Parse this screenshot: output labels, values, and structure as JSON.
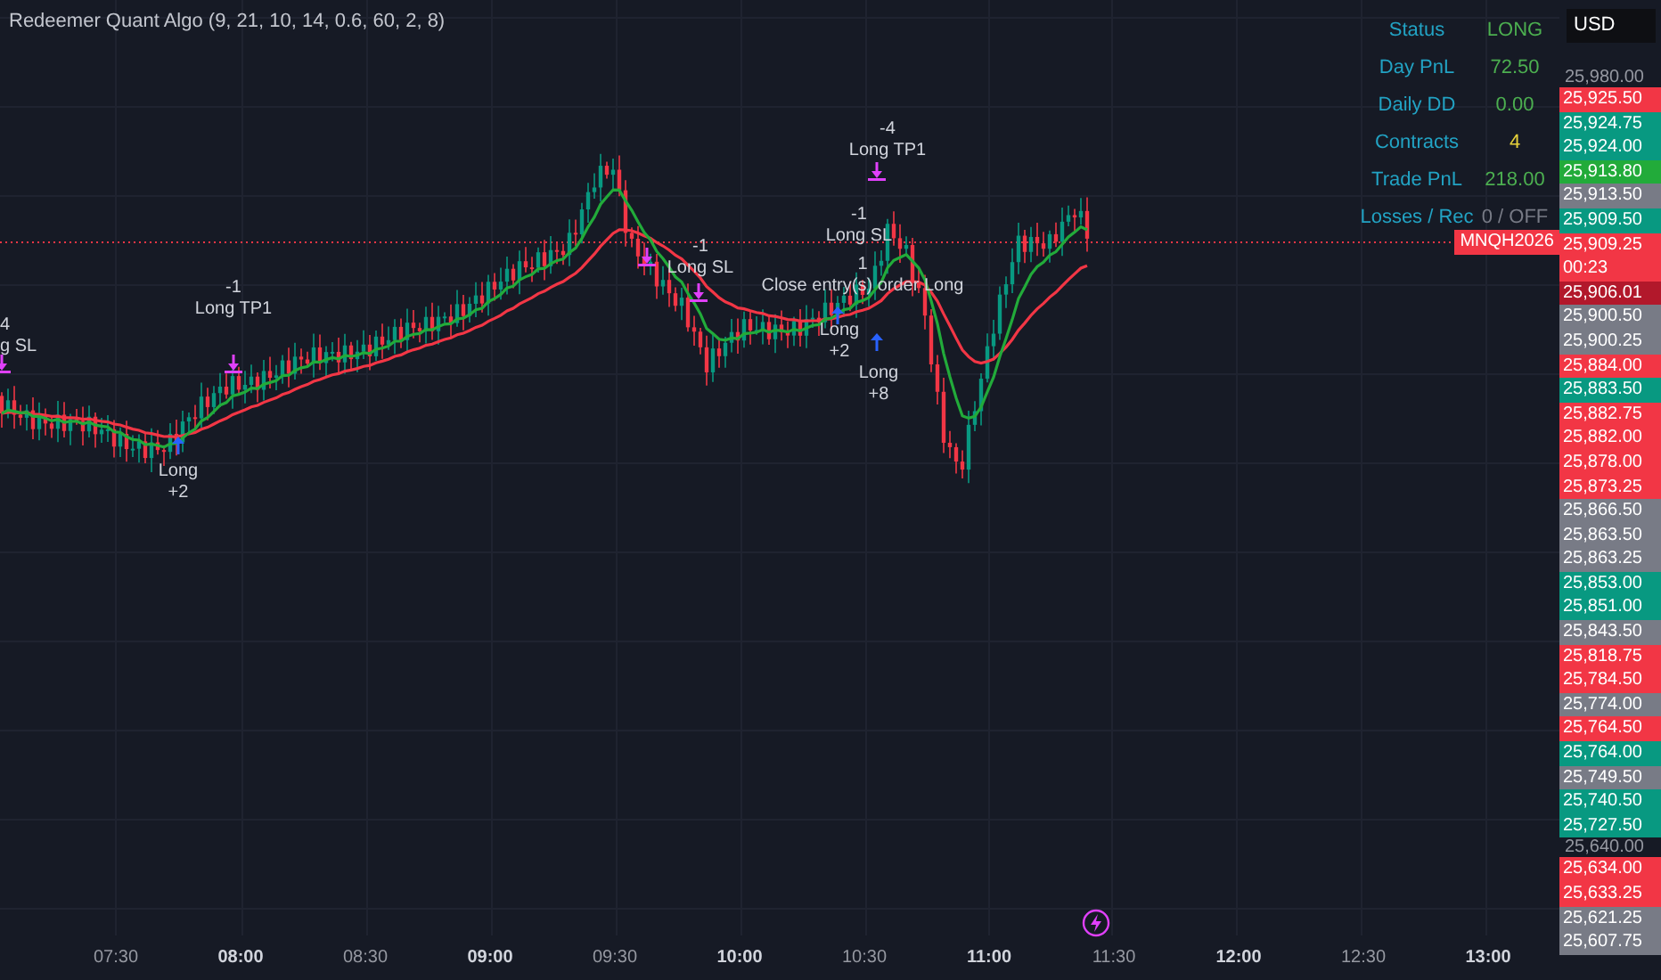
{
  "indicator": {
    "title": "Redeemer Quant Algo (9, 21, 10, 14, 0.6, 60, 2, 8)"
  },
  "stats": [
    {
      "label": "Status",
      "value": "LONG",
      "color": "#4caf50"
    },
    {
      "label": "Day PnL",
      "value": "72.50",
      "color": "#4caf50"
    },
    {
      "label": "Daily DD",
      "value": "0.00",
      "color": "#4caf50"
    },
    {
      "label": "Contracts",
      "value": "4",
      "color": "#e6d13a"
    },
    {
      "label": "Trade PnL",
      "value": "218.00",
      "color": "#4caf50"
    },
    {
      "label": "Losses / Rec",
      "value": "0 / OFF",
      "color": "#787b86"
    }
  ],
  "signals": [
    {
      "kind": "exit",
      "qty": "4",
      "label": "g SL"
    },
    {
      "kind": "exit",
      "qty": "-1",
      "label": "Long TP1"
    },
    {
      "kind": "entry",
      "qty": "+2",
      "label": "Long"
    },
    {
      "kind": "exit",
      "qty": "-1",
      "label": "Long SL"
    },
    {
      "kind": "exit",
      "qty": "-4",
      "label": "Long TP1"
    },
    {
      "kind": "exit",
      "qty": "-1",
      "label": "Long SL"
    },
    {
      "kind": "exit",
      "qty": "1",
      "label": "Close entry(s) order Long"
    },
    {
      "kind": "entry",
      "qty": "+2",
      "label": "Long"
    },
    {
      "kind": "entry",
      "qty": "+8",
      "label": "Long"
    }
  ],
  "symbol_tag": {
    "text": "MNQH2026"
  },
  "currency": {
    "text": "USD"
  },
  "price_scale": [
    {
      "kind": "tick",
      "text": "25,980.00"
    },
    {
      "kind": "tag",
      "text": "25,925.50",
      "color": "#f23645"
    },
    {
      "kind": "tag",
      "text": "25,924.75",
      "color": "#089981"
    },
    {
      "kind": "tag",
      "text": "25,924.00",
      "color": "#089981"
    },
    {
      "kind": "tag",
      "text": "25,913.80",
      "color": "#22ab3a"
    },
    {
      "kind": "tag",
      "text": "25,913.50",
      "color": "#787b86"
    },
    {
      "kind": "tag",
      "text": "25,909.50",
      "color": "#089981"
    },
    {
      "kind": "tag",
      "text": "25,909.25",
      "sub": "00:23",
      "color": "#f23645"
    },
    {
      "kind": "tag",
      "text": "25,906.01",
      "color": "#b2182b"
    },
    {
      "kind": "tag",
      "text": "25,900.50",
      "color": "#787b86"
    },
    {
      "kind": "tag",
      "text": "25,900.25",
      "color": "#787b86"
    },
    {
      "kind": "tag",
      "text": "25,884.00",
      "color": "#f23645"
    },
    {
      "kind": "tag",
      "text": "25,883.50",
      "color": "#089981"
    },
    {
      "kind": "tag",
      "text": "25,882.75",
      "color": "#f23645"
    },
    {
      "kind": "tag",
      "text": "25,882.00",
      "color": "#f23645"
    },
    {
      "kind": "tag",
      "text": "25,878.00",
      "color": "#f23645"
    },
    {
      "kind": "tag",
      "text": "25,873.25",
      "color": "#f23645"
    },
    {
      "kind": "tag",
      "text": "25,866.50",
      "color": "#787b86"
    },
    {
      "kind": "tag",
      "text": "25,863.50",
      "color": "#787b86"
    },
    {
      "kind": "tag",
      "text": "25,863.25",
      "color": "#787b86"
    },
    {
      "kind": "tag",
      "text": "25,853.00",
      "color": "#089981"
    },
    {
      "kind": "tag",
      "text": "25,851.00",
      "color": "#089981"
    },
    {
      "kind": "tag",
      "text": "25,843.50",
      "color": "#787b86"
    },
    {
      "kind": "tag",
      "text": "25,818.75",
      "color": "#f23645"
    },
    {
      "kind": "tag",
      "text": "25,784.50",
      "color": "#f23645"
    },
    {
      "kind": "tag",
      "text": "25,774.00",
      "color": "#787b86"
    },
    {
      "kind": "tag",
      "text": "25,764.50",
      "color": "#f23645"
    },
    {
      "kind": "tag",
      "text": "25,764.00",
      "color": "#089981"
    },
    {
      "kind": "tag",
      "text": "25,749.50",
      "color": "#787b86"
    },
    {
      "kind": "tag",
      "text": "25,740.50",
      "color": "#089981"
    },
    {
      "kind": "tag",
      "text": "25,727.50",
      "color": "#089981"
    },
    {
      "kind": "tick",
      "text": "25,640.00"
    },
    {
      "kind": "tag",
      "text": "25,634.00",
      "color": "#f23645"
    },
    {
      "kind": "tag",
      "text": "25,633.25",
      "color": "#f23645"
    },
    {
      "kind": "tag",
      "text": "25,621.25",
      "color": "#787b86"
    },
    {
      "kind": "tag",
      "text": "25,607.75",
      "color": "#787b86"
    }
  ],
  "time_axis": [
    {
      "text": "07:30",
      "major": false
    },
    {
      "text": "08:00",
      "major": true
    },
    {
      "text": "08:30",
      "major": false
    },
    {
      "text": "09:00",
      "major": true
    },
    {
      "text": "09:30",
      "major": false
    },
    {
      "text": "10:00",
      "major": true
    },
    {
      "text": "10:30",
      "major": false
    },
    {
      "text": "11:00",
      "major": true
    },
    {
      "text": "11:30",
      "major": false
    },
    {
      "text": "12:00",
      "major": true
    },
    {
      "text": "12:30",
      "major": false
    },
    {
      "text": "13:00",
      "major": true
    }
  ]
}
